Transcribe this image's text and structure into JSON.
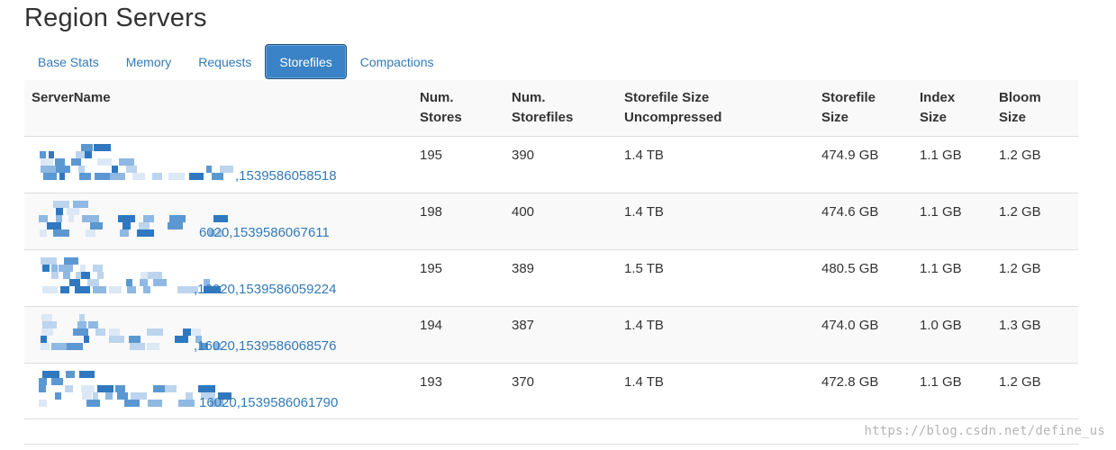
{
  "page": {
    "title": "Region Servers"
  },
  "tabs": [
    {
      "label": "Base Stats",
      "active": false
    },
    {
      "label": "Memory",
      "active": false
    },
    {
      "label": "Requests",
      "active": false
    },
    {
      "label": "Storefiles",
      "active": true
    },
    {
      "label": "Compactions",
      "active": false
    }
  ],
  "table": {
    "headers": {
      "server_name": "ServerName",
      "num_stores_1": "Num.",
      "num_stores_2": "Stores",
      "num_storefiles_1": "Num.",
      "num_storefiles_2": "Storefiles",
      "uncompressed_1": "Storefile Size",
      "uncompressed_2": "Uncompressed",
      "storefile_size_1": "Storefile",
      "storefile_size_2": "Size",
      "index_size_1": "Index",
      "index_size_2": "Size",
      "bloom_size_1": "Bloom",
      "bloom_size_2": "Size"
    },
    "rows": [
      {
        "server_visible": ",1539586058518",
        "num_stores": "195",
        "num_storefiles": "390",
        "uncompressed": "1.4 TB",
        "storefile_size": "474.9 GB",
        "index_size": "1.1 GB",
        "bloom_size": "1.2 GB"
      },
      {
        "server_visible": "6020,1539586067611",
        "num_stores": "198",
        "num_storefiles": "400",
        "uncompressed": "1.4 TB",
        "storefile_size": "474.6 GB",
        "index_size": "1.1 GB",
        "bloom_size": "1.2 GB"
      },
      {
        "server_visible": ",16020,1539586059224",
        "num_stores": "195",
        "num_storefiles": "389",
        "uncompressed": "1.5 TB",
        "storefile_size": "480.5 GB",
        "index_size": "1.1 GB",
        "bloom_size": "1.2 GB"
      },
      {
        "server_visible": ",16020,1539586068576",
        "num_stores": "194",
        "num_storefiles": "387",
        "uncompressed": "1.4 TB",
        "storefile_size": "474.0 GB",
        "index_size": "1.0 GB",
        "bloom_size": "1.3 GB"
      },
      {
        "server_visible": "16020,1539586061790",
        "num_stores": "193",
        "num_storefiles": "370",
        "uncompressed": "1.4 TB",
        "storefile_size": "472.8 GB",
        "index_size": "1.1 GB",
        "bloom_size": "1.2 GB"
      }
    ]
  },
  "watermark": "https://blog.csdn.net/define_us",
  "colors": {
    "link": "#337ab7",
    "active_tab": "#3a83c7",
    "stripe": "#f9f9f9",
    "border": "#dddddd"
  },
  "icons": {
    "redaction": "pixelated-mosaic"
  }
}
